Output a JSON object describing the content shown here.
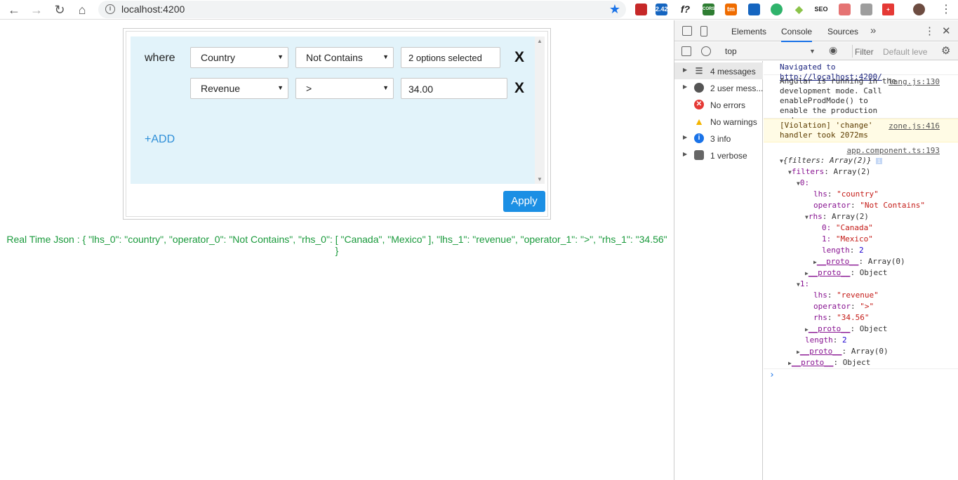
{
  "browser": {
    "url": "localhost:4200",
    "ext_badge": "2.42",
    "ext_f": "f?",
    "ext_cors": "CORS",
    "ext_tm": "tm",
    "ext_seo": "SEO"
  },
  "query_builder": {
    "where_label": "where",
    "rows": [
      {
        "field": "Country",
        "operator": "Not Contains",
        "value": "2 options selected"
      },
      {
        "field": "Revenue",
        "operator": ">",
        "value": "34.00"
      }
    ],
    "remove_label": "X",
    "add_label": "+ADD",
    "apply_label": "Apply"
  },
  "realtime_json": "Real Time Json : { \"lhs_0\": \"country\", \"operator_0\": \"Not Contains\", \"rhs_0\": [ \"Canada\", \"Mexico\" ], \"lhs_1\": \"revenue\", \"operator_1\": \">\", \"rhs_1\": \"34.56\" }",
  "devtools": {
    "tabs": [
      "Elements",
      "Console",
      "Sources"
    ],
    "active_tab": "Console",
    "context": "top",
    "filter_placeholder": "Filter",
    "levels": "Default leve",
    "sidebar": [
      {
        "label": "4 messages"
      },
      {
        "label": "2 user mess..."
      },
      {
        "label": "No errors"
      },
      {
        "label": "No warnings"
      },
      {
        "label": "3 info"
      },
      {
        "label": "1 verbose"
      }
    ],
    "console": {
      "navigated": "Navigated to ",
      "navigated_url": "http://localhost:4200/",
      "angular_msg": "Angular is running in the development mode. Call enableProdMode() to enable the production mode.",
      "angular_src": "lang.js:130",
      "violation_msg": "[Violation] 'change' handler took 2072ms",
      "violation_src": "zone.js:416",
      "app_src": "app.component.ts:193",
      "tree": {
        "root": "{filters: Array(2)}",
        "filters_key": "filters",
        "filters_val": "Array(2)",
        "idx0": "0:",
        "lhs_key": "lhs",
        "lhs0": "\"country\"",
        "operator_key": "operator",
        "operator0": "\"Not Contains\"",
        "rhs_key": "rhs",
        "rhs0_val": "Array(2)",
        "rhs0_0_key": "0:",
        "rhs0_0": "\"Canada\"",
        "rhs0_1_key": "1:",
        "rhs0_1": "\"Mexico\"",
        "length_key": "length",
        "length_2": "2",
        "proto_key": "__proto__",
        "proto_array0": "Array(0)",
        "proto_object": "Object",
        "idx1": "1:",
        "lhs1": "\"revenue\"",
        "operator1": "\">\"",
        "rhs1": "\"34.56\""
      }
    }
  }
}
